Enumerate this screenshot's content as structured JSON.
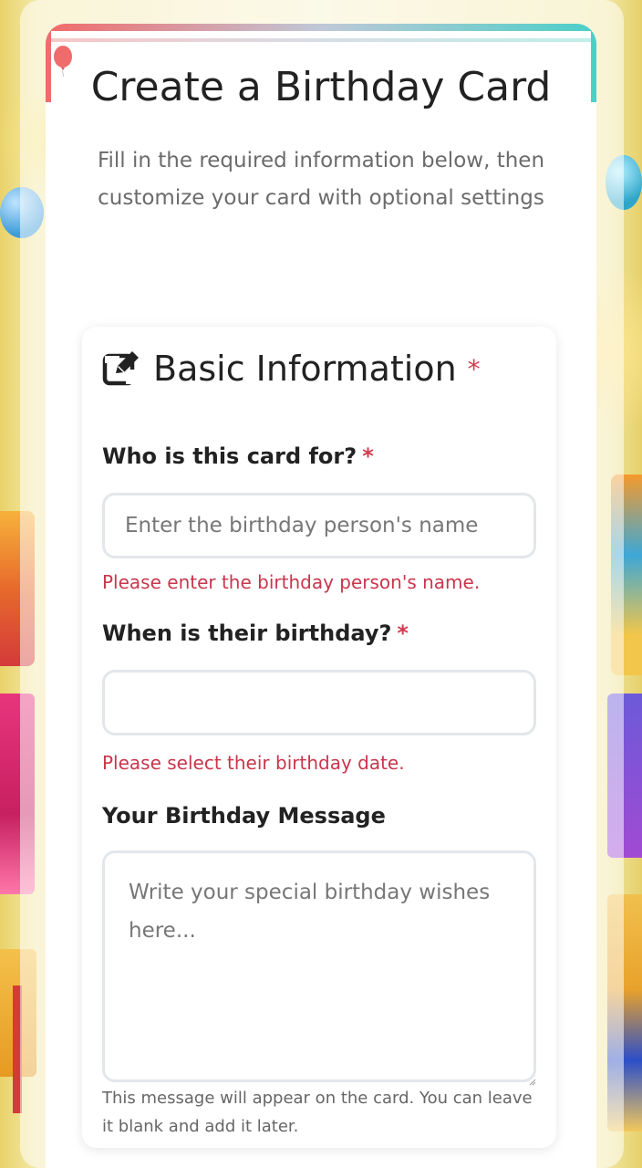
{
  "header": {
    "title": "Create a Birthday Card",
    "subtitle": "Fill in the required information below, then customize your card with optional settings"
  },
  "section": {
    "title": "Basic Information",
    "required_mark": "*"
  },
  "fields": {
    "name": {
      "label": "Who is this card for?",
      "required_mark": "*",
      "value": "",
      "placeholder": "Enter the birthday person's name",
      "error": "Please enter the birthday person's name."
    },
    "date": {
      "label": "When is their birthday?",
      "required_mark": "*",
      "value": "",
      "error": "Please select their birthday date."
    },
    "message": {
      "label": "Your Birthday Message",
      "value": "",
      "placeholder": "Write your special birthday wishes here...",
      "help": "This message will appear on the card. You can leave it blank and add it later."
    }
  },
  "icons": {
    "balloon": "balloon-icon",
    "edit": "edit-icon"
  },
  "colors": {
    "required": "#d23c4f",
    "error": "#c9364c",
    "accent_left": "#f06b6b",
    "accent_right": "#4dcfc8"
  }
}
